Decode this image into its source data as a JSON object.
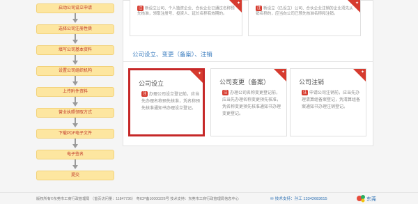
{
  "flow": {
    "steps": [
      "启动公司设立申请",
      "选择公司注册性质",
      "填写公司基本资料",
      "设置公司组织机构",
      "上传附件资料",
      "营业执照领取方式",
      "下载PDF电子文件",
      "电子签名",
      "提交"
    ]
  },
  "top_cards": [
    {
      "badge": "注",
      "text": "新设立公司、个人独资企业、合伙企业已通过名称预先核准，领取注册号、投资人、延长名称有效期的。"
    },
    {
      "badge": "注",
      "text": "新设立（已设立）公司、合伙企业注销的企业须先从销名称的，应当向公司已预先核准名称和注销。"
    }
  ],
  "section": {
    "title": "公司设立、变更（备案）、注销"
  },
  "cards": [
    {
      "title": "公司设立",
      "badge": "注",
      "text": "办理公司设立登记前，应当先办理名称预先核准，凭名称预先核准通知书办理设立登记。"
    },
    {
      "title": "公司变更（备案）",
      "badge": "注",
      "text": "办理公司名称变更登记前，应当先办理名称变更预先核准，凭名称变更预先核准通知书办理变更登记。"
    },
    {
      "title": "公司注销",
      "badge": "注",
      "text": "申请公司注销前，应当先办理清算组备案登记，凭清算组备案通知书办理注销登记。"
    }
  ],
  "footer": {
    "copyright": "版权所有©东莞市工商行政管理局 （首页访问量：11847736） 粤ICP备10000226号 技术支持：东莞市工商行政管理局信息中心",
    "contact_label": "技术支持：孙工",
    "phone": "13342683615",
    "logo_text": "东莞"
  }
}
